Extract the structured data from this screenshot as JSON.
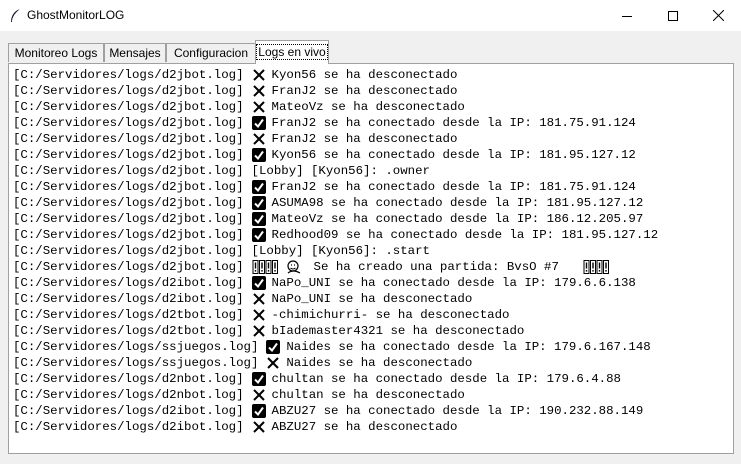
{
  "window": {
    "title": "GhostMonitorLOG",
    "controls": [
      "minimize",
      "maximize",
      "close"
    ]
  },
  "tabs": [
    {
      "label": "Monitoreo Logs",
      "active": false
    },
    {
      "label": "Mensajes",
      "active": false
    },
    {
      "label": "Configuracion",
      "active": false
    },
    {
      "label": "Logs en vivo",
      "active": true
    }
  ],
  "log_lines": [
    {
      "source": "[C:/Servidores/logs/d2jbot.log]",
      "icon": "cross",
      "text": "Kyon56 se ha desconectado"
    },
    {
      "source": "[C:/Servidores/logs/d2jbot.log]",
      "icon": "cross",
      "text": "FranJ2 se ha desconectado"
    },
    {
      "source": "[C:/Servidores/logs/d2jbot.log]",
      "icon": "cross",
      "text": "MateoVz se ha desconectado"
    },
    {
      "source": "[C:/Servidores/logs/d2jbot.log]",
      "icon": "check",
      "text": "FranJ2 se ha conectado desde la IP: 181.75.91.124"
    },
    {
      "source": "[C:/Servidores/logs/d2jbot.log]",
      "icon": "cross",
      "text": "FranJ2 se ha desconectado"
    },
    {
      "source": "[C:/Servidores/logs/d2jbot.log]",
      "icon": "check",
      "text": "Kyon56 se ha conectado desde la IP: 181.95.127.12"
    },
    {
      "source": "[C:/Servidores/logs/d2jbot.log]",
      "icon": "none",
      "text": "[Lobby] [Kyon56]: .owner"
    },
    {
      "source": "[C:/Servidores/logs/d2jbot.log]",
      "icon": "check",
      "text": "FranJ2 se ha conectado desde la IP: 181.75.91.124"
    },
    {
      "source": "[C:/Servidores/logs/d2jbot.log]",
      "icon": "check",
      "text": "ASUMA98 se ha conectado desde la IP: 181.95.127.12"
    },
    {
      "source": "[C:/Servidores/logs/d2jbot.log]",
      "icon": "check",
      "text": "MateoVz se ha conectado desde la IP: 186.12.205.97"
    },
    {
      "source": "[C:/Servidores/logs/d2jbot.log]",
      "icon": "check",
      "text": "Redhood09 se ha conectado desde la IP: 181.95.127.12"
    },
    {
      "source": "[C:/Servidores/logs/d2jbot.log]",
      "icon": "none",
      "text": "[Lobby] [Kyon56]: .start"
    },
    {
      "source": "[C:/Servidores/logs/d2jbot.log]",
      "icon": "game",
      "text": "Se ha creado una partida: BvsO #7"
    },
    {
      "source": "[C:/Servidores/logs/d2ibot.log]",
      "icon": "check",
      "text": "NaPo_UNI se ha conectado desde la IP: 179.6.6.138"
    },
    {
      "source": "[C:/Servidores/logs/d2ibot.log]",
      "icon": "cross",
      "text": "NaPo_UNI se ha desconectado"
    },
    {
      "source": "[C:/Servidores/logs/d2tbot.log]",
      "icon": "cross",
      "text": "-chimichurri- se ha desconectado"
    },
    {
      "source": "[C:/Servidores/logs/d2tbot.log]",
      "icon": "cross",
      "text": "bIademaster4321 se ha desconectado"
    },
    {
      "source": "[C:/Servidores/logs/ssjuegos.log]",
      "icon": "check",
      "text": "Naides se ha conectado desde la IP: 179.6.167.148"
    },
    {
      "source": "[C:/Servidores/logs/ssjuegos.log]",
      "icon": "cross",
      "text": "Naides se ha desconectado"
    },
    {
      "source": "[C:/Servidores/logs/d2nbot.log]",
      "icon": "check",
      "text": "chultan se ha conectado desde la IP: 179.6.4.88"
    },
    {
      "source": "[C:/Servidores/logs/d2nbot.log]",
      "icon": "cross",
      "text": "chultan se ha desconectado"
    },
    {
      "source": "[C:/Servidores/logs/d2ibot.log]",
      "icon": "check",
      "text": "ABZU27 se ha conectado desde la IP: 190.232.88.149"
    },
    {
      "source": "[C:/Servidores/logs/d2ibot.log]",
      "icon": "cross",
      "text": "ABZU27 se ha desconectado"
    }
  ]
}
